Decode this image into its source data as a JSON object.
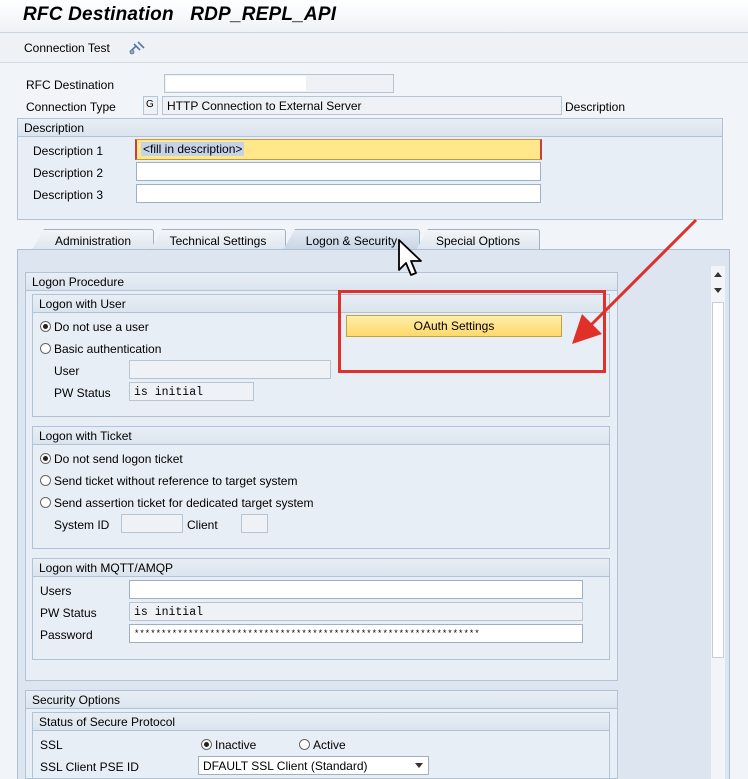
{
  "window": {
    "title": "RFC Destination   RDP_REPL_API"
  },
  "toolbar": {
    "connection_test": "Connection Test",
    "connection_test_icon": "connection-test-icon"
  },
  "header": {
    "rfc_destination_label": "RFC Destination",
    "rfc_destination_value": "",
    "connection_type_label": "Connection Type",
    "connection_type_code": "G",
    "connection_type_value": "HTTP Connection to External Server",
    "description_link": "Description"
  },
  "description": {
    "title": "Description",
    "fields": [
      {
        "label": "Description 1",
        "value": "<fill in description>"
      },
      {
        "label": "Description 2",
        "value": ""
      },
      {
        "label": "Description 3",
        "value": ""
      }
    ]
  },
  "tabs": [
    {
      "label": "Administration",
      "active": false
    },
    {
      "label": "Technical Settings",
      "active": false
    },
    {
      "label": "Logon & Security",
      "active": true
    },
    {
      "label": "Special Options",
      "active": false
    }
  ],
  "logon_procedure": {
    "title": "Logon Procedure",
    "logon_with_user": {
      "title": "Logon with User",
      "options": [
        {
          "label": "Do not use a user",
          "selected": true
        },
        {
          "label": "Basic authentication",
          "selected": false
        }
      ],
      "user_label": "User",
      "user_value": "",
      "pw_status_label": "PW Status",
      "pw_status_value": "is initial",
      "oauth_button": "OAuth Settings"
    },
    "logon_with_ticket": {
      "title": "Logon with Ticket",
      "options": [
        {
          "label": "Do not send logon ticket",
          "selected": true
        },
        {
          "label": "Send ticket without reference to target system",
          "selected": false
        },
        {
          "label": "Send assertion ticket for dedicated target system",
          "selected": false
        }
      ],
      "system_id_label": "System ID",
      "system_id_value": "",
      "client_label": "Client",
      "client_value": ""
    },
    "logon_with_mqtt": {
      "title": "Logon with MQTT/AMQP",
      "users_label": "Users",
      "users_value": "",
      "pw_status_label": "PW Status",
      "pw_status_value": "is initial",
      "password_label": "Password",
      "password_value": "****************************************************************"
    }
  },
  "security_options": {
    "title": "Security Options",
    "secure_protocol": {
      "title": "Status of Secure Protocol",
      "ssl_label": "SSL",
      "ssl_inactive": "Inactive",
      "ssl_active": "Active",
      "ssl_selected": "Inactive",
      "pse_label": "SSL Client PSE ID",
      "pse_value": "DFAULT SSL Client (Standard)"
    }
  },
  "colors": {
    "highlight_red": "#e0302a",
    "button_yellow": "#ffd96b",
    "group_blue": "#e8eef5"
  }
}
